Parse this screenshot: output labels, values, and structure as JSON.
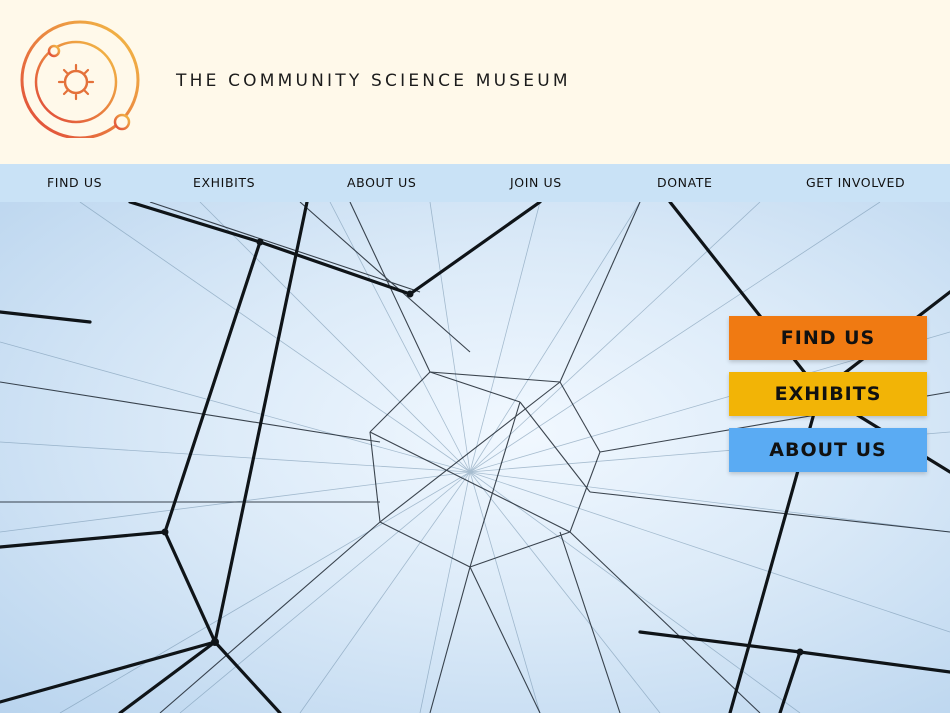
{
  "header": {
    "title": "THE COMMUNITY SCIENCE MUSEUM",
    "logo_icon": "solar-system-orbit-icon"
  },
  "nav": {
    "items": [
      {
        "label": "FIND US"
      },
      {
        "label": "EXHIBITS"
      },
      {
        "label": "ABOUT US"
      },
      {
        "label": "JOIN US"
      },
      {
        "label": "DONATE"
      },
      {
        "label": "GET INVOLVED"
      }
    ]
  },
  "hero": {
    "image": "network-string-structure-photo",
    "buttons": [
      {
        "label": "FIND US",
        "color": "#f07a12"
      },
      {
        "label": "EXHIBITS",
        "color": "#f2b406"
      },
      {
        "label": "ABOUT US",
        "color": "#5aabf3"
      }
    ]
  },
  "colors": {
    "header_bg": "#fff9ea",
    "nav_bg": "#c9e2f6",
    "logo_orange": "#e0643a",
    "logo_yellow": "#f0b33a"
  }
}
